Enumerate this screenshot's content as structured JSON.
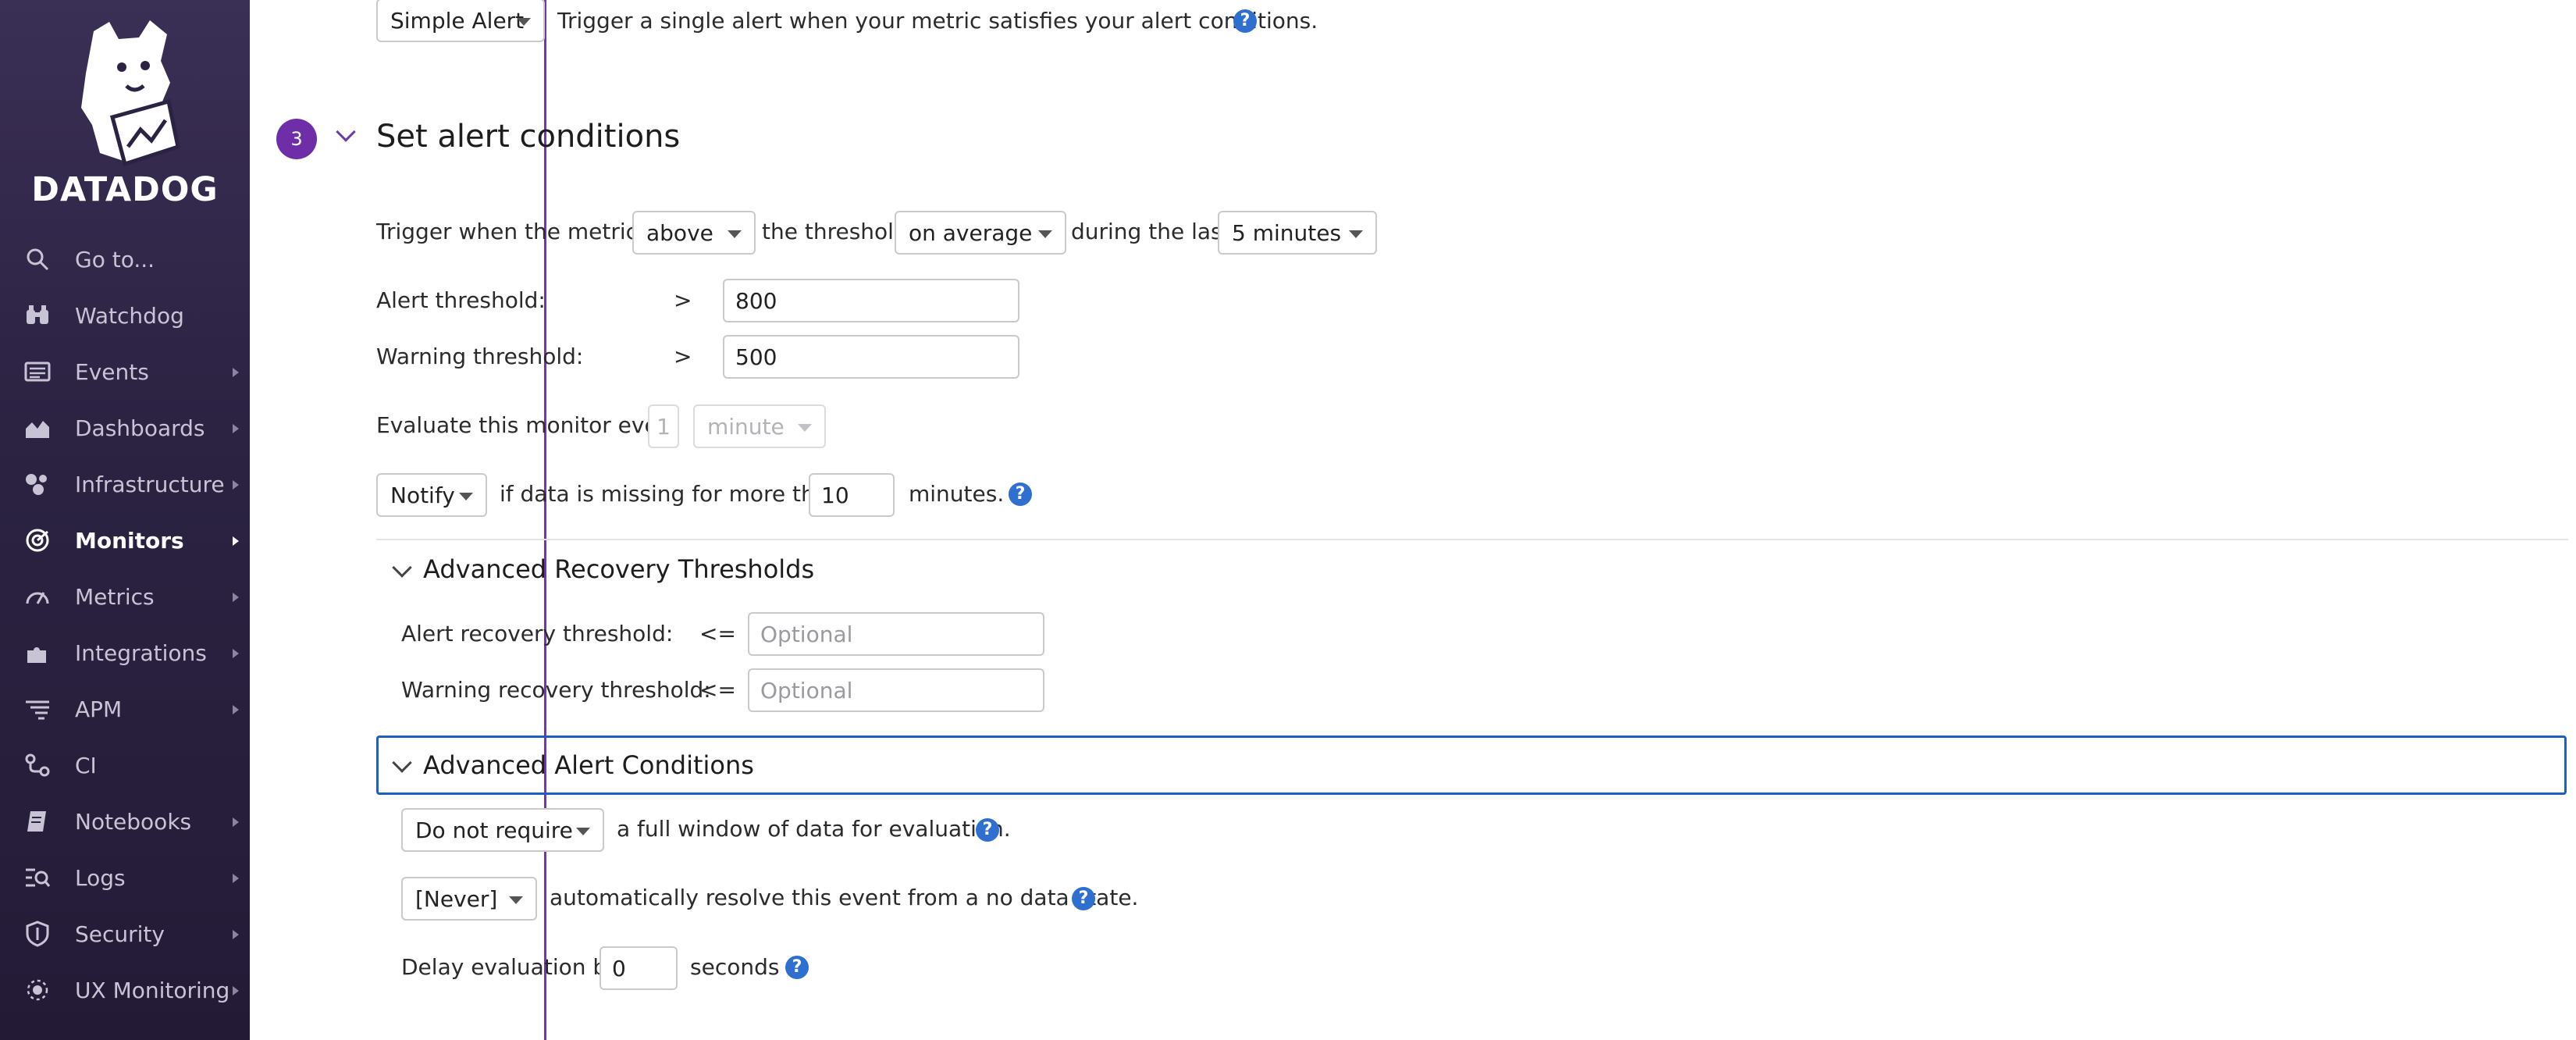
{
  "sidebar": {
    "brand": "DATADOG",
    "items": [
      {
        "label": "Go to...",
        "icon": "search-icon",
        "arrow": false,
        "active": false
      },
      {
        "label": "Watchdog",
        "icon": "binoculars-icon",
        "arrow": false,
        "active": false
      },
      {
        "label": "Events",
        "icon": "events-list-icon",
        "arrow": true,
        "active": false
      },
      {
        "label": "Dashboards",
        "icon": "area-chart-icon",
        "arrow": true,
        "active": false
      },
      {
        "label": "Infrastructure",
        "icon": "hexagons-icon",
        "arrow": true,
        "active": false
      },
      {
        "label": "Monitors",
        "icon": "radar-icon",
        "arrow": true,
        "active": true
      },
      {
        "label": "Metrics",
        "icon": "gauge-icon",
        "arrow": true,
        "active": false
      },
      {
        "label": "Integrations",
        "icon": "puzzle-icon",
        "arrow": true,
        "active": false
      },
      {
        "label": "APM",
        "icon": "apm-lines-icon",
        "arrow": true,
        "active": false
      },
      {
        "label": "CI",
        "icon": "pipeline-icon",
        "arrow": false,
        "active": false
      },
      {
        "label": "Notebooks",
        "icon": "notebook-icon",
        "arrow": true,
        "active": false
      },
      {
        "label": "Logs",
        "icon": "logs-icon",
        "arrow": true,
        "active": false
      },
      {
        "label": "Security",
        "icon": "shield-icon",
        "arrow": true,
        "active": false
      },
      {
        "label": "UX Monitoring",
        "icon": "ux-icon",
        "arrow": true,
        "active": false
      }
    ]
  },
  "top_row": {
    "select_value": "Simple Alert",
    "description": "Trigger a single alert when your metric satisfies your alert conditions."
  },
  "section": {
    "number": "3",
    "title": "Set alert conditions"
  },
  "trigger": {
    "prefix": "Trigger when the metric is",
    "comparator": "above",
    "middle": "the threshold",
    "aggregation": "on average",
    "during": "during the last",
    "window": "5 minutes"
  },
  "thresholds": {
    "alert_label": "Alert threshold:",
    "alert_op": ">",
    "alert_value": "800",
    "warning_label": "Warning threshold:",
    "warning_op": ">",
    "warning_value": "500"
  },
  "evaluate": {
    "label": "Evaluate this monitor every",
    "number": "1",
    "unit": "minute"
  },
  "missing": {
    "action": "Notify",
    "text": "if data is missing for more than",
    "value": "10",
    "suffix": "minutes."
  },
  "recovery": {
    "title": "Advanced Recovery Thresholds",
    "alert_label": "Alert recovery threshold:",
    "alert_op": "<=",
    "alert_placeholder": "Optional",
    "warning_label": "Warning recovery threshold:",
    "warning_op": "<=",
    "warning_placeholder": "Optional"
  },
  "advanced": {
    "title": "Advanced Alert Conditions",
    "window_select": "Do not require",
    "window_text": "a full window of data for evaluation.",
    "resolve_select": "[Never]",
    "resolve_text": "automatically resolve this event from a no data state.",
    "delay_label": "Delay evaluation by",
    "delay_value": "0",
    "delay_suffix": "seconds"
  },
  "help_glyph": "?",
  "colors": {
    "sidebar_bg": "#2c2343",
    "accent_purple": "#6f2da8",
    "help_blue": "#2f6fcf",
    "focus_blue": "#1f5fbf"
  }
}
